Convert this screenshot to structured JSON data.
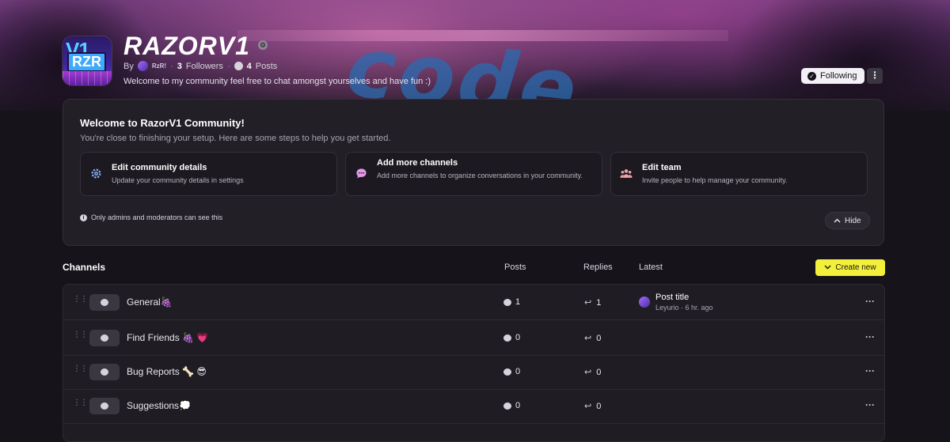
{
  "community": {
    "title": "RAZORV1",
    "by_label": "By",
    "owner_name": "RzR!",
    "followers_count": "3",
    "followers_label": "Followers",
    "posts_count": "4",
    "posts_label": "Posts",
    "description": "Welcome to my community feel free to chat amongst yourselves and have fun :)",
    "avatar_text_top": "V1",
    "avatar_text_main": "RZR",
    "banner_text": "code"
  },
  "actions": {
    "following_label": "Following",
    "more_label": "⋮"
  },
  "setup": {
    "heading": "Welcome to RazorV1 Community!",
    "subheading": "You're close to finishing your setup. Here are some steps to help you get started.",
    "steps": [
      {
        "title": "Edit community details",
        "desc": "Update your community details in settings",
        "icon": "gear-icon"
      },
      {
        "title": "Add more channels",
        "desc": "Add more channels to organize conversations in your community.",
        "icon": "chat-icon"
      },
      {
        "title": "Edit team",
        "desc": "Invite people to help manage your community.",
        "icon": "team-icon"
      }
    ],
    "admins_note": "Only admins and moderators can see this",
    "hide_label": "Hide"
  },
  "channels": {
    "heading": "Channels",
    "col_posts": "Posts",
    "col_replies": "Replies",
    "col_latest": "Latest",
    "create_label": "Create new",
    "rows": [
      {
        "name": "General🍇",
        "posts": "1",
        "replies": "1",
        "latest_title": "Post title",
        "latest_meta": "Leyurio · 6 hr. ago"
      },
      {
        "name": "Find Friends 🍇 💗",
        "posts": "0",
        "replies": "0"
      },
      {
        "name": "Bug Reports 🦴 😎",
        "posts": "0",
        "replies": "0"
      },
      {
        "name": "Suggestions💭",
        "posts": "0",
        "replies": "0"
      }
    ]
  },
  "colors": {
    "accent_yellow": "#f2f03a",
    "background": "#16141a",
    "card": "#221f27"
  }
}
